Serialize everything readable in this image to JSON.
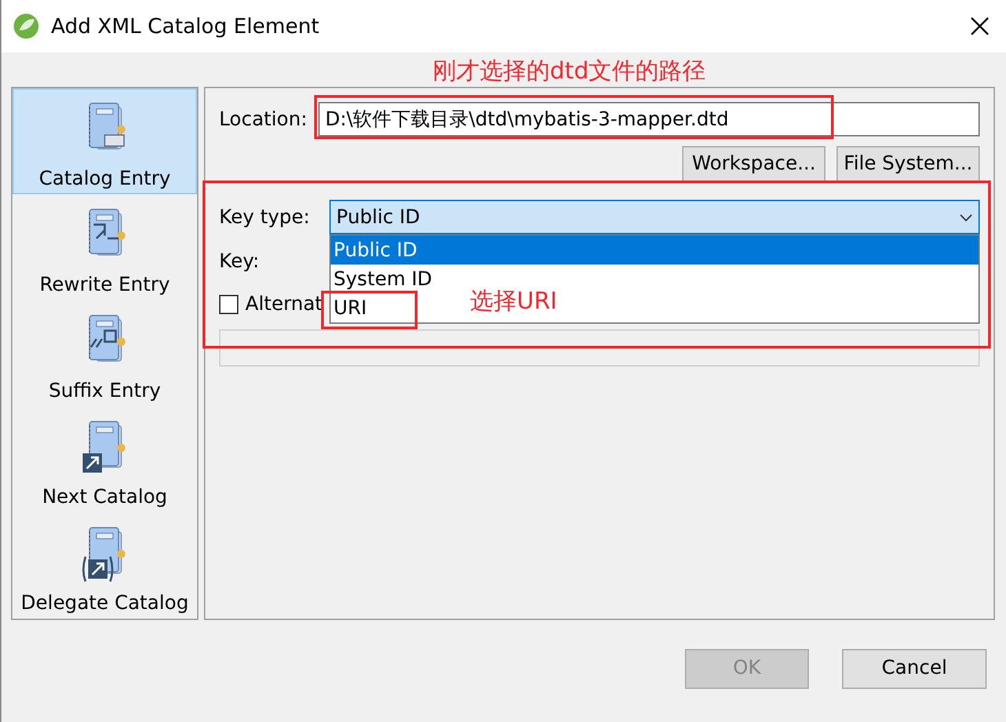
{
  "window": {
    "title": "Add XML Catalog Element"
  },
  "sidebar": {
    "items": [
      {
        "label": "Catalog Entry",
        "kind": "entry",
        "selected": true
      },
      {
        "label": "Rewrite Entry",
        "kind": "rewrite",
        "selected": false
      },
      {
        "label": "Suffix Entry",
        "kind": "suffix",
        "selected": false
      },
      {
        "label": "Next Catalog",
        "kind": "next",
        "selected": false
      },
      {
        "label": "Delegate Catalog",
        "kind": "delegate",
        "selected": false
      }
    ]
  },
  "form": {
    "location_label": "Location:",
    "location_value": "D:\\软件下载目录\\dtd\\mybatis-3-mapper.dtd",
    "buttons": [
      "Workspace...",
      "File System..."
    ],
    "key_type_label": "Key type:",
    "key_type_value": "Public ID",
    "key_type_options": [
      {
        "label": "Public ID",
        "selected": true
      },
      {
        "label": "System ID",
        "selected": false
      },
      {
        "label": "URI",
        "selected": false
      }
    ],
    "key_label": "Key:",
    "alternative_label": "Alternat",
    "alternative_checked": false
  },
  "annotations": [
    {
      "text": "刚才选择的dtd文件的路径"
    },
    {
      "text": "选择URI"
    }
  ],
  "footer": {
    "buttons": [
      {
        "label": "OK",
        "disabled": true
      },
      {
        "label": "Cancel",
        "disabled": false
      }
    ]
  }
}
